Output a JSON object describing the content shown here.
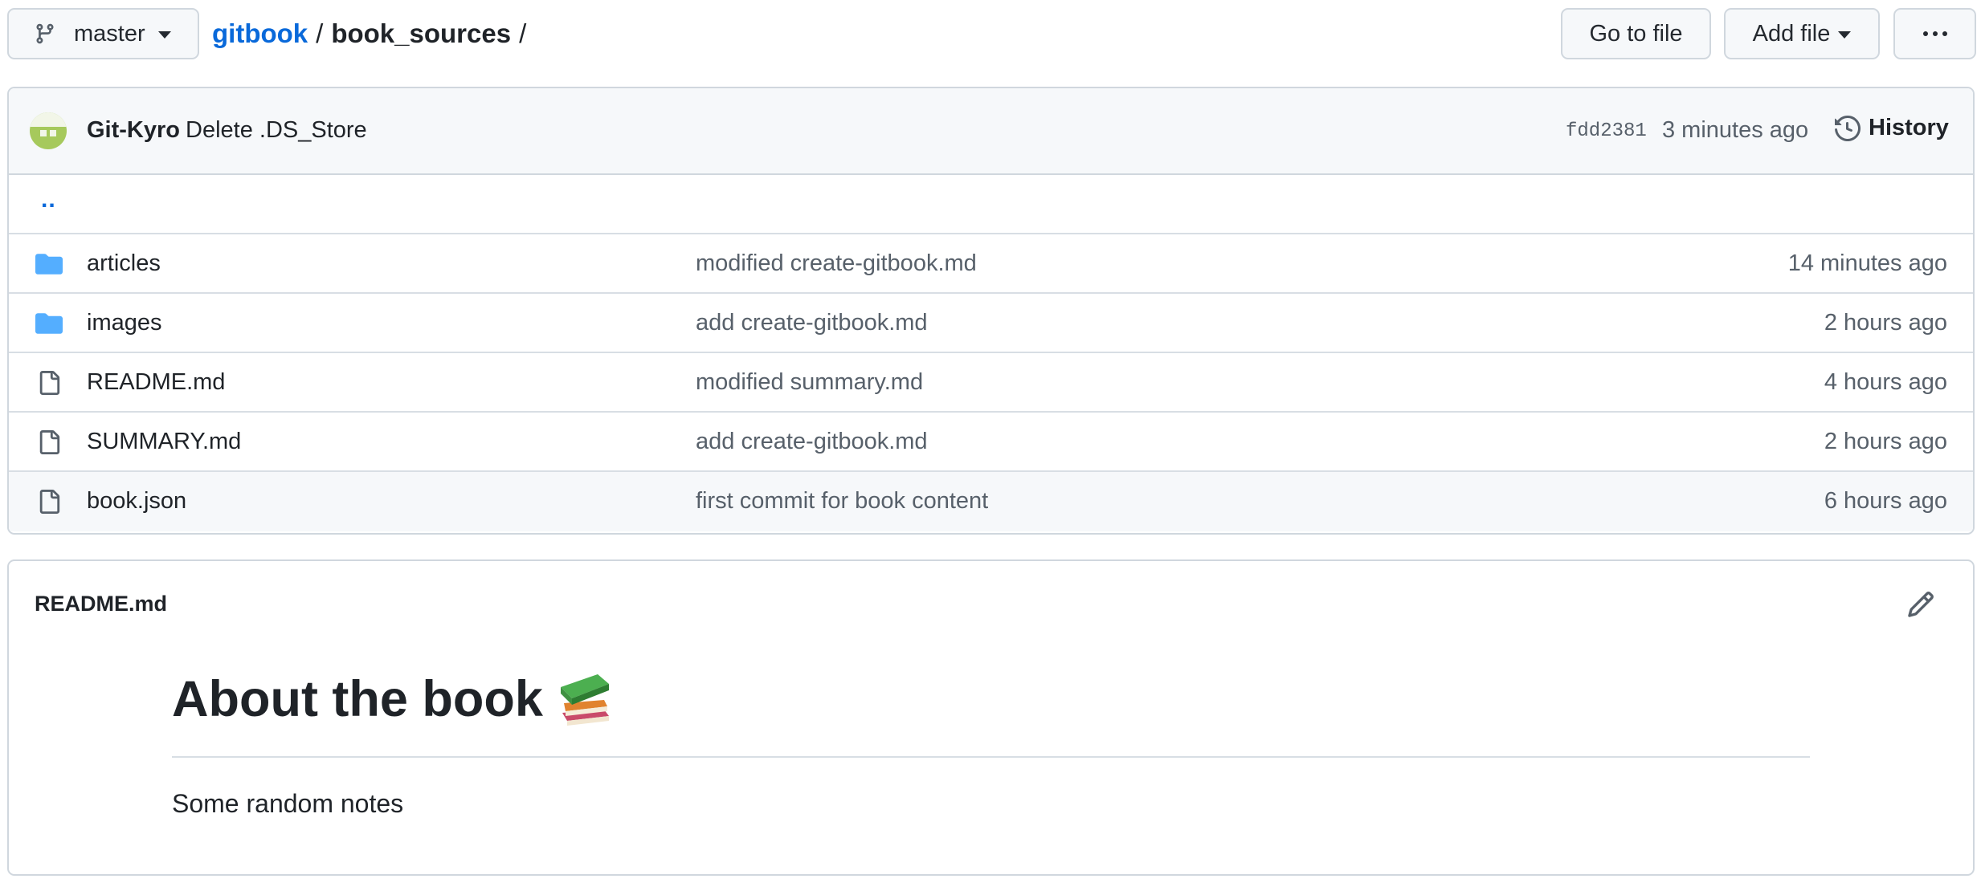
{
  "branch": {
    "name": "master"
  },
  "breadcrumb": {
    "repo": "gitbook",
    "separator": "/",
    "folder": "book_sources",
    "trailing": "/"
  },
  "actions": {
    "go_to_file": "Go to file",
    "add_file": "Add file",
    "more": "More options"
  },
  "commit": {
    "author": "Git-Kyro",
    "message": "Delete .DS_Store",
    "sha": "fdd2381",
    "time": "3 minutes ago",
    "history_label": "History"
  },
  "parent_link": "..",
  "files": [
    {
      "type": "folder",
      "icon": "folder-icon",
      "name": "articles",
      "message": "modified create-gitbook.md",
      "age": "14 minutes ago"
    },
    {
      "type": "folder",
      "icon": "folder-icon",
      "name": "images",
      "message": "add create-gitbook.md",
      "age": "2 hours ago"
    },
    {
      "type": "file",
      "icon": "file-icon",
      "name": "README.md",
      "message": "modified summary.md",
      "age": "4 hours ago"
    },
    {
      "type": "file",
      "icon": "file-icon",
      "name": "SUMMARY.md",
      "message": "add create-gitbook.md",
      "age": "2 hours ago"
    },
    {
      "type": "file",
      "icon": "file-icon",
      "name": "book.json",
      "message": "first commit for book content",
      "age": "6 hours ago"
    }
  ],
  "readme": {
    "filename": "README.md",
    "heading": "About the book",
    "heading_emoji": "books-emoji",
    "paragraph": "Some random notes"
  },
  "colors": {
    "link": "#0969da",
    "folder": "#54aeff",
    "muted": "#57606a",
    "border": "#d0d7de",
    "header_bg": "#f6f8fa"
  }
}
